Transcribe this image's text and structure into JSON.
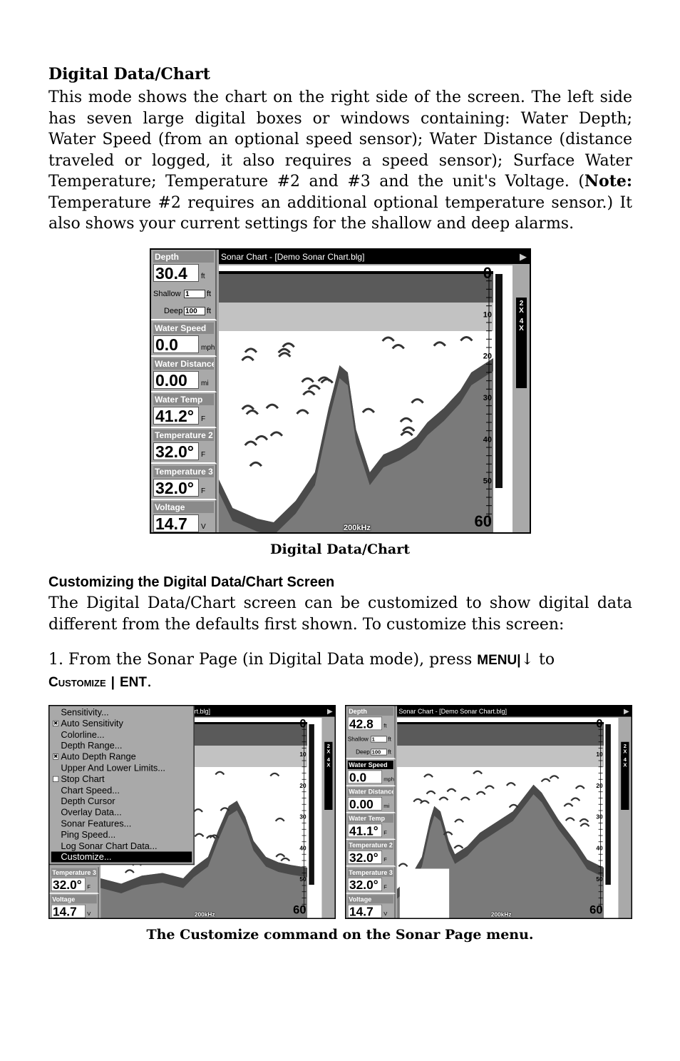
{
  "section1": {
    "heading": "Digital Data/Chart",
    "paragraph_parts": [
      "This mode shows the chart on the right side of the screen. The left side has seven large digital boxes or windows containing: Water Depth; Water Speed (from an optional speed sensor); Water Distance (distance traveled or logged, it also requires a speed sensor); Surface Water Temperature; Tem­perature #2 and #3 and the unit's Voltage. (",
      "Note:",
      " Temperature #2 requires an additional optional temperature sensor.) It also shows your current set­tings for the shallow and deep alarms."
    ],
    "figure_caption": "Digital Data/Chart"
  },
  "section2": {
    "heading": "Customizing the Digital Data/Chart Screen",
    "paragraph": "The Digital Data/Chart screen can be customized to show digital data different from the defaults first shown. To customize this screen:",
    "step": {
      "text_before": "1. From the Sonar Page (in Digital Data mode), press ",
      "key_menu": "MENU",
      "separator": "|",
      "arrow": "↓",
      "text_to": " to",
      "key_customize": "Customize",
      "key_ent": "ENT",
      "end": "."
    },
    "figure_caption": "The Customize command on the Sonar Page menu."
  },
  "screens": [
    {
      "id": "screen-main",
      "chart_title": "Sonar Chart - [Demo Sonar Chart.blg]",
      "frequency": "200kHz",
      "depth_scale": [
        "0",
        "10",
        "20",
        "30",
        "40",
        "50",
        "60"
      ],
      "zoom_tabs": [
        "2X",
        "4X"
      ],
      "panels": [
        {
          "label": "Depth",
          "value": "30.4",
          "unit": "ft",
          "shallow_label": "Shallow",
          "shallow": "1",
          "deep_label": "Deep",
          "deep": "100",
          "alarm_unit": "ft"
        },
        {
          "label": "Water Speed",
          "value": "0.0",
          "unit": "mph"
        },
        {
          "label": "Water Distance",
          "value": "0.00",
          "unit": "mi"
        },
        {
          "label": "Water Temp",
          "value": "41.2°",
          "unit": "F"
        },
        {
          "label": "Temperature 2",
          "value": "32.0°",
          "unit": "F"
        },
        {
          "label": "Temperature 3",
          "value": "32.0°",
          "unit": "F"
        },
        {
          "label": "Voltage",
          "value": "14.7",
          "unit": "V"
        }
      ]
    },
    {
      "id": "screen-menu",
      "chart_title": "Sonar Chart - [Demo Sonar Chart.blg]",
      "frequency": "200kHz",
      "depth_scale": [
        "0",
        "10",
        "20",
        "30",
        "40",
        "50",
        "60"
      ],
      "zoom_tabs": [
        "2X",
        "4X"
      ],
      "panels": [
        {
          "label": "Temperature 3",
          "value": "32.0°",
          "unit": "F",
          "slot": 5
        },
        {
          "label": "Voltage",
          "value": "14.7",
          "unit": "V",
          "slot": 6
        }
      ],
      "menu": [
        {
          "label": "Sensitivity..."
        },
        {
          "label": "Auto Sensitivity",
          "checkbox": true,
          "checked": true
        },
        {
          "label": "Colorline..."
        },
        {
          "label": "Depth Range..."
        },
        {
          "label": "Auto Depth Range",
          "checkbox": true,
          "checked": true
        },
        {
          "label": "Upper And Lower Limits..."
        },
        {
          "label": "Stop Chart",
          "checkbox": true,
          "checked": false
        },
        {
          "label": "Chart Speed..."
        },
        {
          "label": "Depth Cursor"
        },
        {
          "label": "Overlay Data..."
        },
        {
          "label": "Sonar Features..."
        },
        {
          "label": "Ping Speed..."
        },
        {
          "label": "Log Sonar Chart Data..."
        },
        {
          "label": "Customize...",
          "selected": true
        }
      ]
    },
    {
      "id": "screen-customize",
      "chart_title": "Sonar Chart - [Demo Sonar Chart.blg]",
      "frequency": "200kHz",
      "depth_scale": [
        "0",
        "10",
        "20",
        "30",
        "40",
        "50",
        "60"
      ],
      "zoom_tabs": [
        "2X",
        "4X"
      ],
      "selected_panel": "Water Speed",
      "panels": [
        {
          "label": "Depth",
          "value": "42.8",
          "unit": "ft",
          "shallow_label": "Shallow",
          "shallow": "1",
          "deep_label": "Deep",
          "deep": "100",
          "alarm_unit": "ft"
        },
        {
          "label": "Water Speed",
          "value": "0.0",
          "unit": "mph",
          "selected": true
        },
        {
          "label": "Water Distance",
          "value": "0.00",
          "unit": "mi"
        },
        {
          "label": "Water Temp",
          "value": "41.1°",
          "unit": "F"
        },
        {
          "label": "Temperature 2",
          "value": "32.0°",
          "unit": "F"
        },
        {
          "label": "Temperature 3",
          "value": "32.0°",
          "unit": "F"
        },
        {
          "label": "Voltage",
          "value": "14.7",
          "unit": "V"
        }
      ]
    }
  ],
  "colors": {
    "screen_gray": "#a9a9a9",
    "header_gray": "#8a8a8a",
    "selected": "#000000"
  }
}
